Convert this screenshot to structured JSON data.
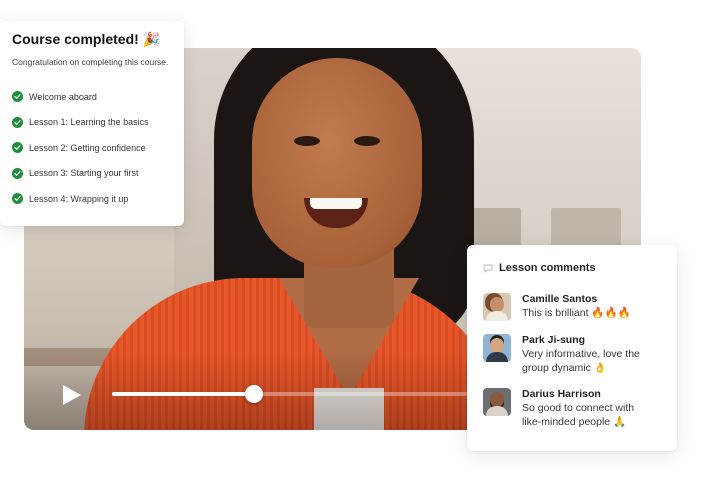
{
  "course": {
    "title": "Course completed! 🎉",
    "subtitle": "Congratulation on completing this course.",
    "lessons": [
      {
        "label": "Welcome aboard",
        "status": "completed"
      },
      {
        "label": "Lesson 1: Learning the basics",
        "status": "completed"
      },
      {
        "label": "Lesson 2: Getting confidence",
        "status": "completed"
      },
      {
        "label": "Lesson 3: Starting your first",
        "status": "completed"
      },
      {
        "label": "Lesson 4: Wrapping it up",
        "status": "completed"
      }
    ],
    "check_color": "#1e8e3e"
  },
  "video": {
    "progress": 0.4,
    "play_icon": "play-icon"
  },
  "comments": {
    "title": "Lesson comments",
    "icon": "speech-bubble-icon",
    "items": [
      {
        "name": "Camille Santos",
        "text": "This is brilliant 🔥🔥🔥"
      },
      {
        "name": "Park Ji-sung",
        "text": "Very informative, love the group dynamic 👌"
      },
      {
        "name": "Darius Harrison",
        "text": "So good to connect with like-minded people 🙏"
      }
    ]
  }
}
